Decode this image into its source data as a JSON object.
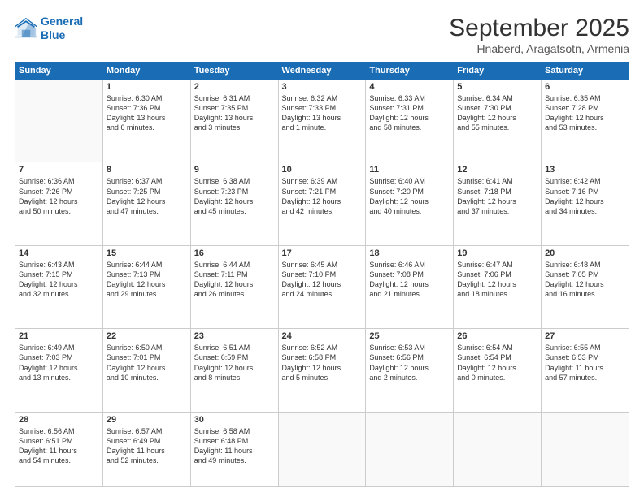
{
  "header": {
    "logo_line1": "General",
    "logo_line2": "Blue",
    "title": "September 2025",
    "subtitle": "Hnaberd, Aragatsotn, Armenia"
  },
  "days_of_week": [
    "Sunday",
    "Monday",
    "Tuesday",
    "Wednesday",
    "Thursday",
    "Friday",
    "Saturday"
  ],
  "weeks": [
    [
      {
        "day": "",
        "info": ""
      },
      {
        "day": "1",
        "info": "Sunrise: 6:30 AM\nSunset: 7:36 PM\nDaylight: 13 hours\nand 6 minutes."
      },
      {
        "day": "2",
        "info": "Sunrise: 6:31 AM\nSunset: 7:35 PM\nDaylight: 13 hours\nand 3 minutes."
      },
      {
        "day": "3",
        "info": "Sunrise: 6:32 AM\nSunset: 7:33 PM\nDaylight: 13 hours\nand 1 minute."
      },
      {
        "day": "4",
        "info": "Sunrise: 6:33 AM\nSunset: 7:31 PM\nDaylight: 12 hours\nand 58 minutes."
      },
      {
        "day": "5",
        "info": "Sunrise: 6:34 AM\nSunset: 7:30 PM\nDaylight: 12 hours\nand 55 minutes."
      },
      {
        "day": "6",
        "info": "Sunrise: 6:35 AM\nSunset: 7:28 PM\nDaylight: 12 hours\nand 53 minutes."
      }
    ],
    [
      {
        "day": "7",
        "info": "Sunrise: 6:36 AM\nSunset: 7:26 PM\nDaylight: 12 hours\nand 50 minutes."
      },
      {
        "day": "8",
        "info": "Sunrise: 6:37 AM\nSunset: 7:25 PM\nDaylight: 12 hours\nand 47 minutes."
      },
      {
        "day": "9",
        "info": "Sunrise: 6:38 AM\nSunset: 7:23 PM\nDaylight: 12 hours\nand 45 minutes."
      },
      {
        "day": "10",
        "info": "Sunrise: 6:39 AM\nSunset: 7:21 PM\nDaylight: 12 hours\nand 42 minutes."
      },
      {
        "day": "11",
        "info": "Sunrise: 6:40 AM\nSunset: 7:20 PM\nDaylight: 12 hours\nand 40 minutes."
      },
      {
        "day": "12",
        "info": "Sunrise: 6:41 AM\nSunset: 7:18 PM\nDaylight: 12 hours\nand 37 minutes."
      },
      {
        "day": "13",
        "info": "Sunrise: 6:42 AM\nSunset: 7:16 PM\nDaylight: 12 hours\nand 34 minutes."
      }
    ],
    [
      {
        "day": "14",
        "info": "Sunrise: 6:43 AM\nSunset: 7:15 PM\nDaylight: 12 hours\nand 32 minutes."
      },
      {
        "day": "15",
        "info": "Sunrise: 6:44 AM\nSunset: 7:13 PM\nDaylight: 12 hours\nand 29 minutes."
      },
      {
        "day": "16",
        "info": "Sunrise: 6:44 AM\nSunset: 7:11 PM\nDaylight: 12 hours\nand 26 minutes."
      },
      {
        "day": "17",
        "info": "Sunrise: 6:45 AM\nSunset: 7:10 PM\nDaylight: 12 hours\nand 24 minutes."
      },
      {
        "day": "18",
        "info": "Sunrise: 6:46 AM\nSunset: 7:08 PM\nDaylight: 12 hours\nand 21 minutes."
      },
      {
        "day": "19",
        "info": "Sunrise: 6:47 AM\nSunset: 7:06 PM\nDaylight: 12 hours\nand 18 minutes."
      },
      {
        "day": "20",
        "info": "Sunrise: 6:48 AM\nSunset: 7:05 PM\nDaylight: 12 hours\nand 16 minutes."
      }
    ],
    [
      {
        "day": "21",
        "info": "Sunrise: 6:49 AM\nSunset: 7:03 PM\nDaylight: 12 hours\nand 13 minutes."
      },
      {
        "day": "22",
        "info": "Sunrise: 6:50 AM\nSunset: 7:01 PM\nDaylight: 12 hours\nand 10 minutes."
      },
      {
        "day": "23",
        "info": "Sunrise: 6:51 AM\nSunset: 6:59 PM\nDaylight: 12 hours\nand 8 minutes."
      },
      {
        "day": "24",
        "info": "Sunrise: 6:52 AM\nSunset: 6:58 PM\nDaylight: 12 hours\nand 5 minutes."
      },
      {
        "day": "25",
        "info": "Sunrise: 6:53 AM\nSunset: 6:56 PM\nDaylight: 12 hours\nand 2 minutes."
      },
      {
        "day": "26",
        "info": "Sunrise: 6:54 AM\nSunset: 6:54 PM\nDaylight: 12 hours\nand 0 minutes."
      },
      {
        "day": "27",
        "info": "Sunrise: 6:55 AM\nSunset: 6:53 PM\nDaylight: 11 hours\nand 57 minutes."
      }
    ],
    [
      {
        "day": "28",
        "info": "Sunrise: 6:56 AM\nSunset: 6:51 PM\nDaylight: 11 hours\nand 54 minutes."
      },
      {
        "day": "29",
        "info": "Sunrise: 6:57 AM\nSunset: 6:49 PM\nDaylight: 11 hours\nand 52 minutes."
      },
      {
        "day": "30",
        "info": "Sunrise: 6:58 AM\nSunset: 6:48 PM\nDaylight: 11 hours\nand 49 minutes."
      },
      {
        "day": "",
        "info": ""
      },
      {
        "day": "",
        "info": ""
      },
      {
        "day": "",
        "info": ""
      },
      {
        "day": "",
        "info": ""
      }
    ]
  ]
}
